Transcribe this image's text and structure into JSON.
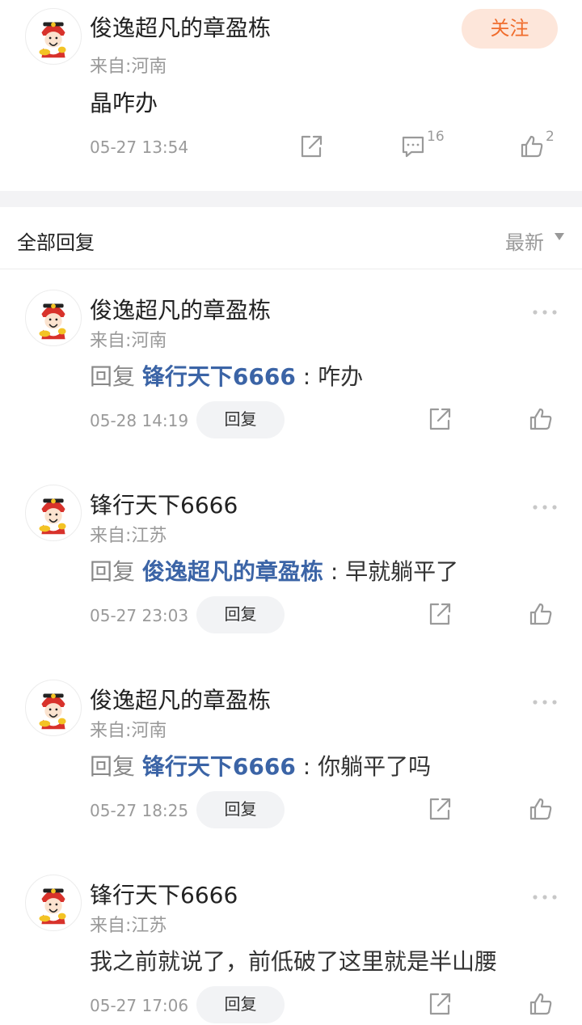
{
  "post": {
    "username": "俊逸超凡的章盈栋",
    "location": "来自:河南",
    "text": "晶咋办",
    "follow_label": "关注",
    "time": "05-27 13:54",
    "comment_count": "16",
    "like_count": "2"
  },
  "section": {
    "title": "全部回复",
    "sort_label": "最新"
  },
  "replies": [
    {
      "username": "俊逸超凡的章盈栋",
      "location": "来自:河南",
      "prefix": "回复 ",
      "target": "锋行天下6666",
      "body": " : 咋办",
      "time": "05-28 14:19",
      "reply_label": "回复"
    },
    {
      "username": "锋行天下6666",
      "location": "来自:江苏",
      "prefix": "回复 ",
      "target": "俊逸超凡的章盈栋",
      "body": " : 早就躺平了",
      "time": "05-27 23:03",
      "reply_label": "回复"
    },
    {
      "username": "俊逸超凡的章盈栋",
      "location": "来自:河南",
      "prefix": "回复 ",
      "target": "锋行天下6666",
      "body": " : 你躺平了吗",
      "time": "05-27 18:25",
      "reply_label": "回复"
    },
    {
      "username": "锋行天下6666",
      "location": "来自:江苏",
      "prefix": "",
      "target": "",
      "body": "我之前就说了，前低破了这里就是半山腰",
      "time": "05-27 17:06",
      "reply_label": "回复"
    }
  ],
  "colors": {
    "accent": "#f06c2c",
    "link": "#3b64a6",
    "muted": "#999999"
  }
}
